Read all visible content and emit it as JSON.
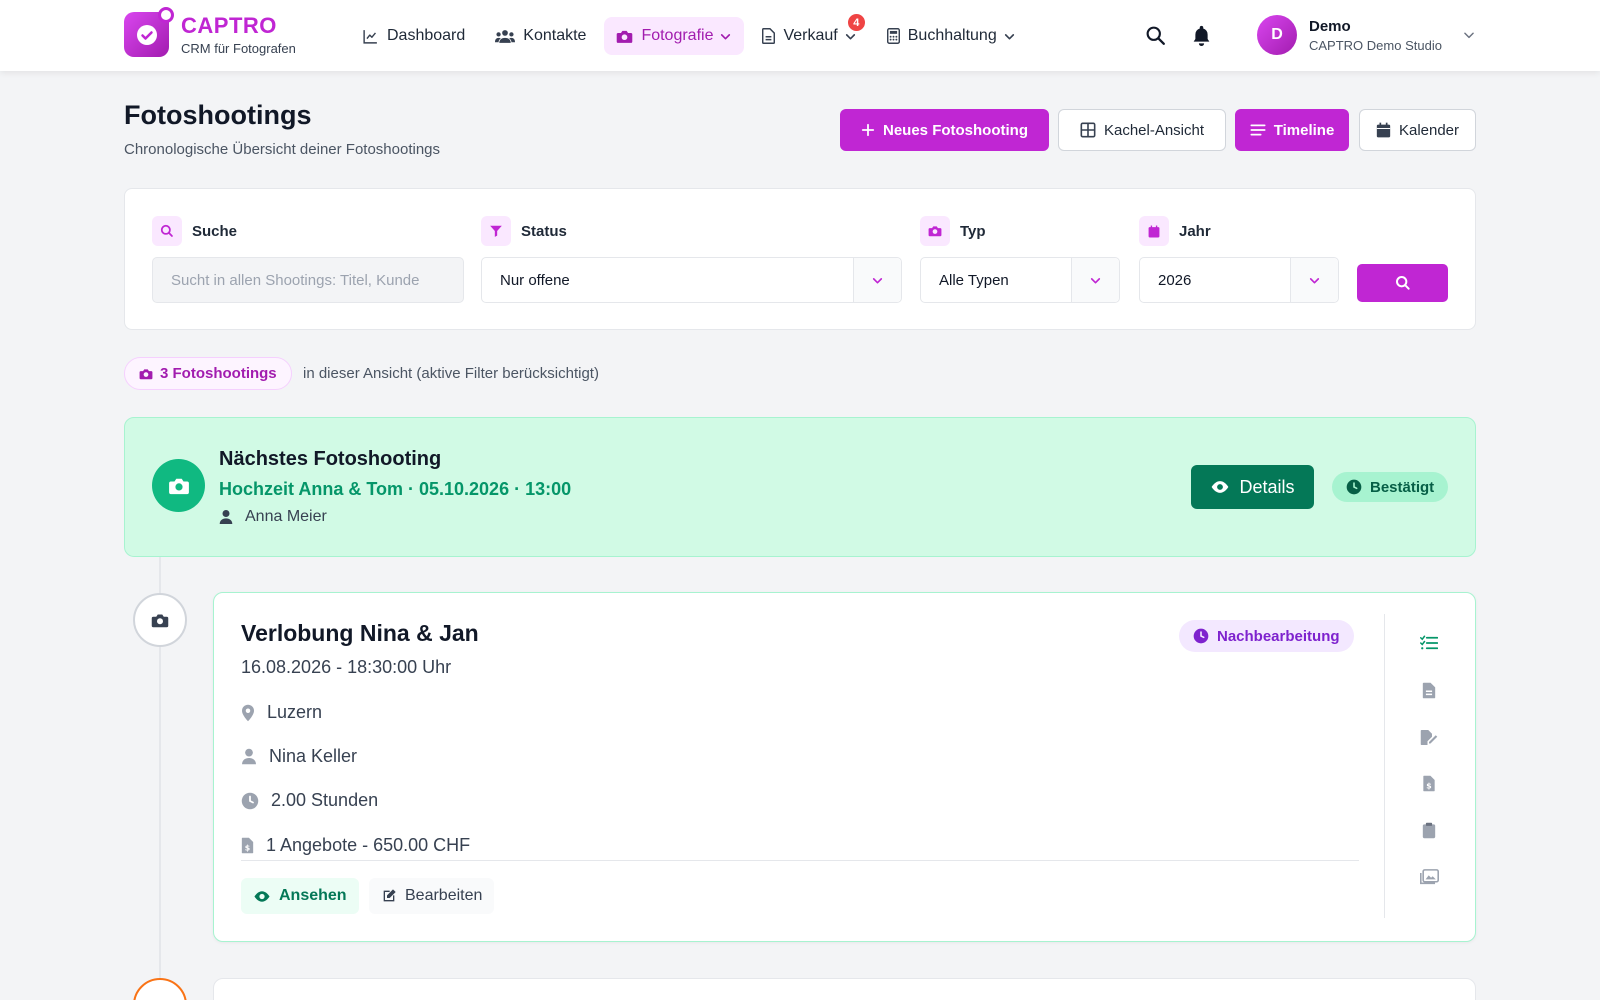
{
  "app": {
    "name": "CAPTRO",
    "tagline": "CRM für Fotografen"
  },
  "nav": {
    "dashboard": "Dashboard",
    "contacts": "Kontakte",
    "photography": "Fotografie",
    "sales": "Verkauf",
    "sales_badge": "4",
    "accounting": "Buchhaltung"
  },
  "user": {
    "initial": "D",
    "name": "Demo",
    "org": "CAPTRO Demo Studio"
  },
  "page": {
    "title": "Fotoshootings",
    "subtitle": "Chronologische Übersicht deiner Fotoshootings",
    "actions": {
      "new": "Neues Fotoshooting",
      "tiles": "Kachel-Ansicht",
      "timeline": "Timeline",
      "calendar": "Kalender"
    }
  },
  "filters": {
    "search_label": "Suche",
    "search_placeholder": "Sucht in allen Shootings: Titel, Kunde",
    "status_label": "Status",
    "status_value": "Nur offene",
    "type_label": "Typ",
    "type_value": "Alle Typen",
    "year_label": "Jahr",
    "year_value": "2026"
  },
  "summary": {
    "count": "3 Fotoshootings",
    "note": "in dieser Ansicht (aktive Filter berücksichtigt)"
  },
  "next": {
    "title": "Nächstes Fotoshooting",
    "subtitle": "Hochzeit Anna & Tom · 05.10.2026 · 13:00",
    "client": "Anna Meier",
    "details": "Details",
    "status": "Bestätigt"
  },
  "shootings": [
    {
      "title": "Verlobung Nina & Jan",
      "datetime": "16.08.2026 - 18:30:00 Uhr",
      "status": "Nachbearbeitung",
      "location": "Luzern",
      "client": "Nina Keller",
      "duration": "2.00 Stunden",
      "offers": "1 Angebote - 650.00 CHF",
      "view": "Ansehen",
      "edit": "Bearbeiten"
    }
  ],
  "colors": {
    "brand": "#c026d3",
    "success": "#047857",
    "accent_bg": "#d1fae5"
  }
}
